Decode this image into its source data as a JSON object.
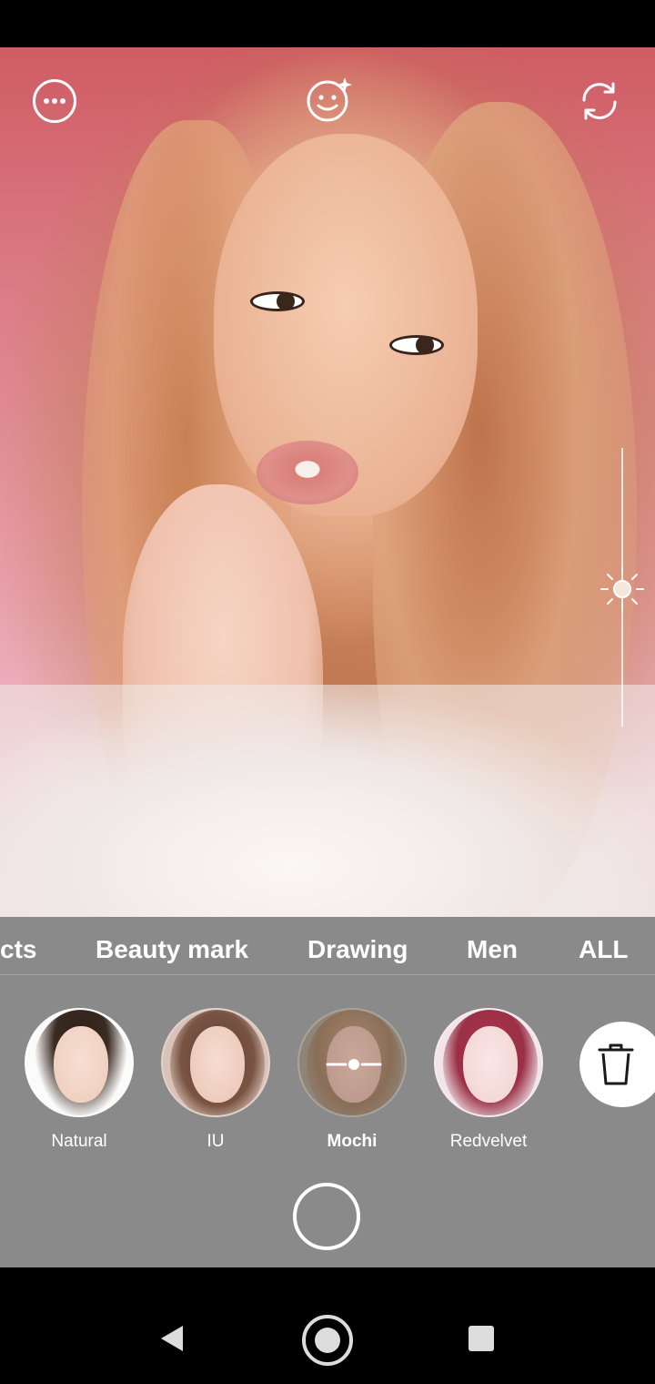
{
  "camera": {
    "more_icon": "more-horizontal-icon",
    "face_effect_icon": "smile-sparkle-icon",
    "switch_camera_icon": "camera-rotate-icon",
    "exposure_icon": "sun-icon"
  },
  "tabs": [
    {
      "label": "cts"
    },
    {
      "label": "Beauty mark"
    },
    {
      "label": "Drawing"
    },
    {
      "label": "Men"
    },
    {
      "label": "ALL"
    }
  ],
  "filters": [
    {
      "label": "Natural",
      "selected": false
    },
    {
      "label": "IU",
      "selected": false
    },
    {
      "label": "Mochi",
      "selected": true
    },
    {
      "label": "Redvelvet",
      "selected": false
    }
  ],
  "delete_icon": "trash-icon",
  "navigation": {
    "back_icon": "triangle-back-icon",
    "home_icon": "circle-home-icon",
    "recents_icon": "square-recents-icon"
  },
  "colors": {
    "panel": "#8a8a8a",
    "accent": "#ffffff"
  }
}
